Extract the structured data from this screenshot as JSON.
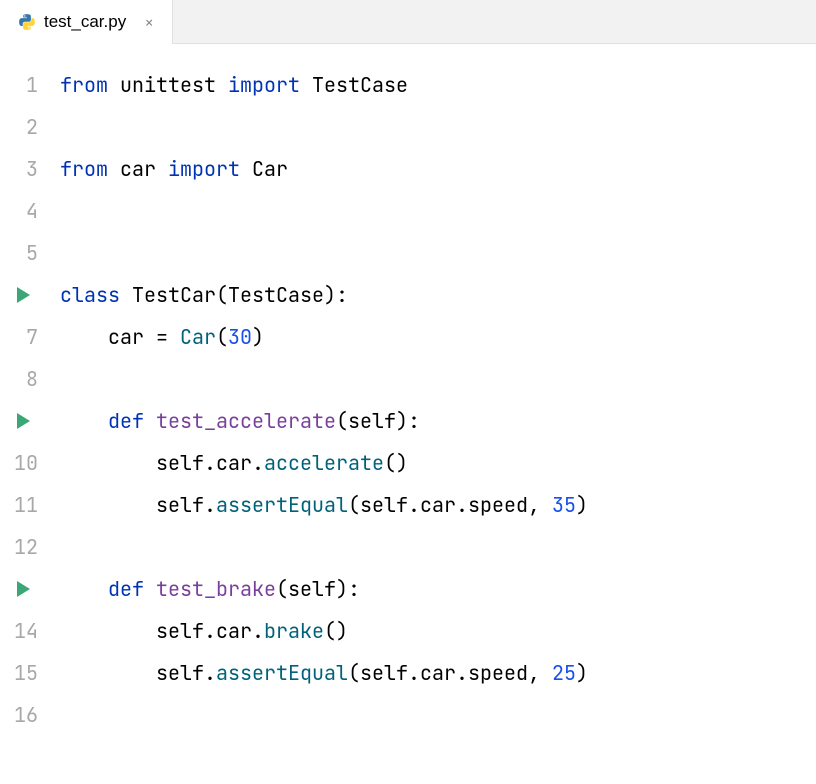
{
  "tab": {
    "filename": "test_car.py",
    "close_glyph": "×"
  },
  "gutter": {
    "lines": [
      "1",
      "2",
      "3",
      "4",
      "5",
      "",
      "7",
      "8",
      "",
      "10",
      "11",
      "12",
      "",
      "14",
      "15",
      "16"
    ],
    "runnable_lines": [
      6,
      9,
      13
    ]
  },
  "code": {
    "l1": {
      "s1": "from ",
      "s2": "unittest ",
      "s3": "import ",
      "s4": "TestCase"
    },
    "l3": {
      "s1": "from ",
      "s2": "car ",
      "s3": "import ",
      "s4": "Car"
    },
    "l6": {
      "s1": "class ",
      "s2": "TestCar",
      "s3": "(TestCase):"
    },
    "l7": {
      "s1": "    car = ",
      "s2": "Car",
      "s3": "(",
      "s4": "30",
      "s5": ")"
    },
    "l9": {
      "s1": "    ",
      "s2": "def ",
      "s3": "test_accelerate",
      "s4": "(self):"
    },
    "l10": {
      "s1": "        self.car.",
      "s2": "accelerate",
      "s3": "()"
    },
    "l11": {
      "s1": "        self.",
      "s2": "assertEqual",
      "s3": "(self.car.speed, ",
      "s4": "35",
      "s5": ")"
    },
    "l13": {
      "s1": "    ",
      "s2": "def ",
      "s3": "test_brake",
      "s4": "(self):"
    },
    "l14": {
      "s1": "        self.car.",
      "s2": "brake",
      "s3": "()"
    },
    "l15": {
      "s1": "        self.",
      "s2": "assertEqual",
      "s3": "(self.car.speed, ",
      "s4": "25",
      "s5": ")"
    }
  }
}
